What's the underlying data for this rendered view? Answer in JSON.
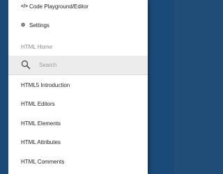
{
  "drawer": {
    "top_items": [
      {
        "label": "Code Playground/Editor",
        "icon": "code-brackets-icon",
        "glyph": "</>"
      },
      {
        "label": "Settings",
        "icon": "gear-icon",
        "glyph": "⚙"
      }
    ],
    "section_label": "HTML Home",
    "search": {
      "placeholder": "Search",
      "icon": "search-icon"
    },
    "menu_items": [
      {
        "label": "HTML5 Introduction"
      },
      {
        "label": "HTML Editors"
      },
      {
        "label": "HTML Elements"
      },
      {
        "label": "HTML Attributes"
      },
      {
        "label": "HTML Comments"
      }
    ]
  },
  "colors": {
    "backdrop": "#1f4d78",
    "drawer_bg": "#ffffff",
    "search_bg": "#ececec",
    "section_text": "#8a8a8a",
    "item_text": "#222222"
  }
}
